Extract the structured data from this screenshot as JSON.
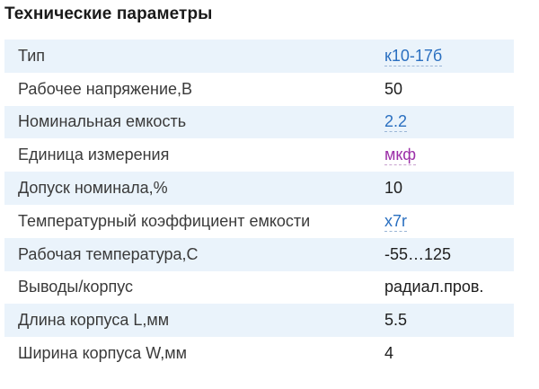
{
  "section": {
    "title": "Технические параметры"
  },
  "rows": [
    {
      "label": "Тип",
      "value": "к10-17б",
      "link": true,
      "link_color": "#2a6fc0"
    },
    {
      "label": "Рабочее напряжение,В",
      "value": "50",
      "link": false
    },
    {
      "label": "Номинальная емкость",
      "value": "2.2",
      "link": true,
      "link_color": "#2a6fc0"
    },
    {
      "label": "Единица измерения",
      "value": "мкф",
      "link": true,
      "link_color": "#9c2fa8"
    },
    {
      "label": "Допуск номинала,%",
      "value": "10",
      "link": false
    },
    {
      "label": "Температурный коэффициент емкости",
      "value": "x7r",
      "link": true,
      "link_color": "#2a6fc0"
    },
    {
      "label": "Рабочая температура,С",
      "value": "-55…125",
      "link": false
    },
    {
      "label": "Выводы/корпус",
      "value": "радиал.пров.",
      "link": false
    },
    {
      "label": "Длина корпуса L,мм",
      "value": "5.5",
      "link": false
    },
    {
      "label": "Ширина корпуса W,мм",
      "value": "4",
      "link": false
    }
  ]
}
